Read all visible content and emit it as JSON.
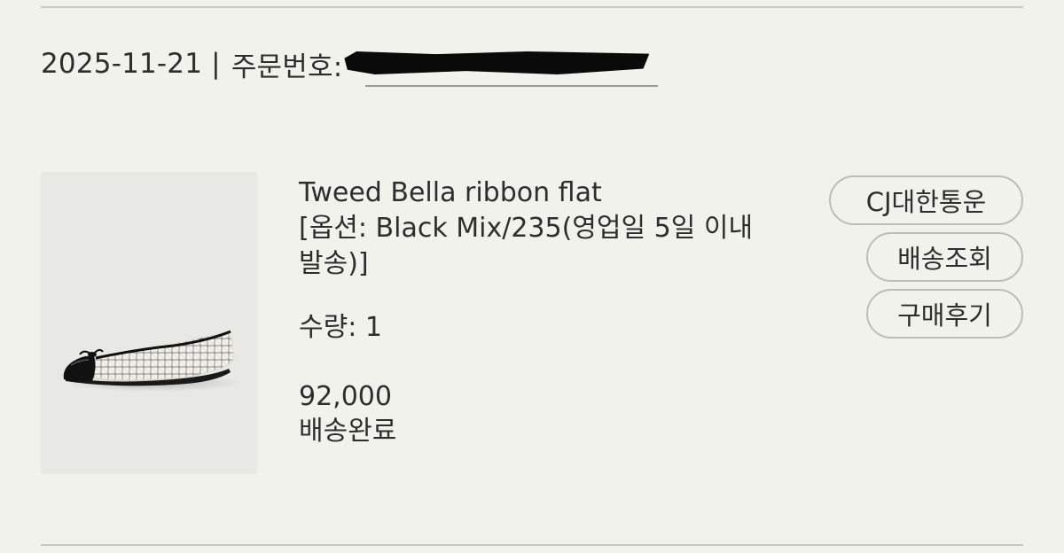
{
  "order": {
    "date": "2025-11-21",
    "separator": "|",
    "order_number_label": "주문번호:"
  },
  "product": {
    "image_icon": "shoe-photo",
    "name": "Tweed Bella ribbon flat",
    "option": "[옵션: Black Mix/235(영업일 5일 이내 발송)]",
    "quantity": "수량: 1",
    "price": "92,000",
    "status": "배송완료"
  },
  "actions": {
    "courier_label": "CJ대한통운",
    "track_label": "배송조회",
    "review_label": "구매후기"
  },
  "colors": {
    "background": "#f2f2ed",
    "text": "#2e2e2e",
    "border": "#bdbdb8"
  }
}
